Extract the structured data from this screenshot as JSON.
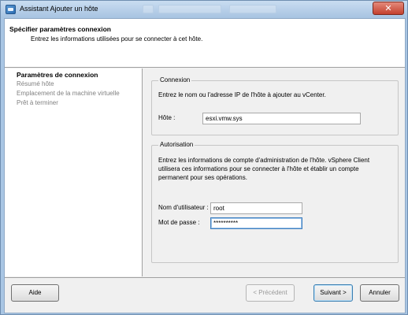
{
  "window": {
    "title": "Assistant Ajouter un hôte",
    "close_glyph": "✕",
    "icon": "vsphere-wizard-icon"
  },
  "header": {
    "title": "Spécifier paramètres connexion",
    "description": "Entrez les informations utilisées pour se connecter à cet hôte."
  },
  "steps": [
    {
      "label": "Paramètres de connexion",
      "active": true
    },
    {
      "label": "Résumé hôte",
      "active": false
    },
    {
      "label": "Emplacement de la machine virtuelle",
      "active": false
    },
    {
      "label": "Prêt à terminer",
      "active": false
    }
  ],
  "connexion": {
    "legend": "Connexion",
    "instructions": "Entrez le nom ou l'adresse IP de l'hôte à ajouter au vCenter.",
    "host_label": "Hôte :",
    "host_value": "esxi.vmw.sys"
  },
  "autorisation": {
    "legend": "Autorisation",
    "instructions": "Entrez les informations de compte d'administration de l'hôte. vSphere Client utilisera ces informations pour se connecter à l'hôte et établir un compte permanent pour ses opérations.",
    "username_label": "Nom d'utilisateur :",
    "username_value": "root",
    "password_label": "Mot de passe :",
    "password_value": "**********"
  },
  "footer": {
    "help_label": "Aide",
    "back_label": "< Précédent",
    "next_label": "Suivant >",
    "cancel_label": "Annuler"
  }
}
